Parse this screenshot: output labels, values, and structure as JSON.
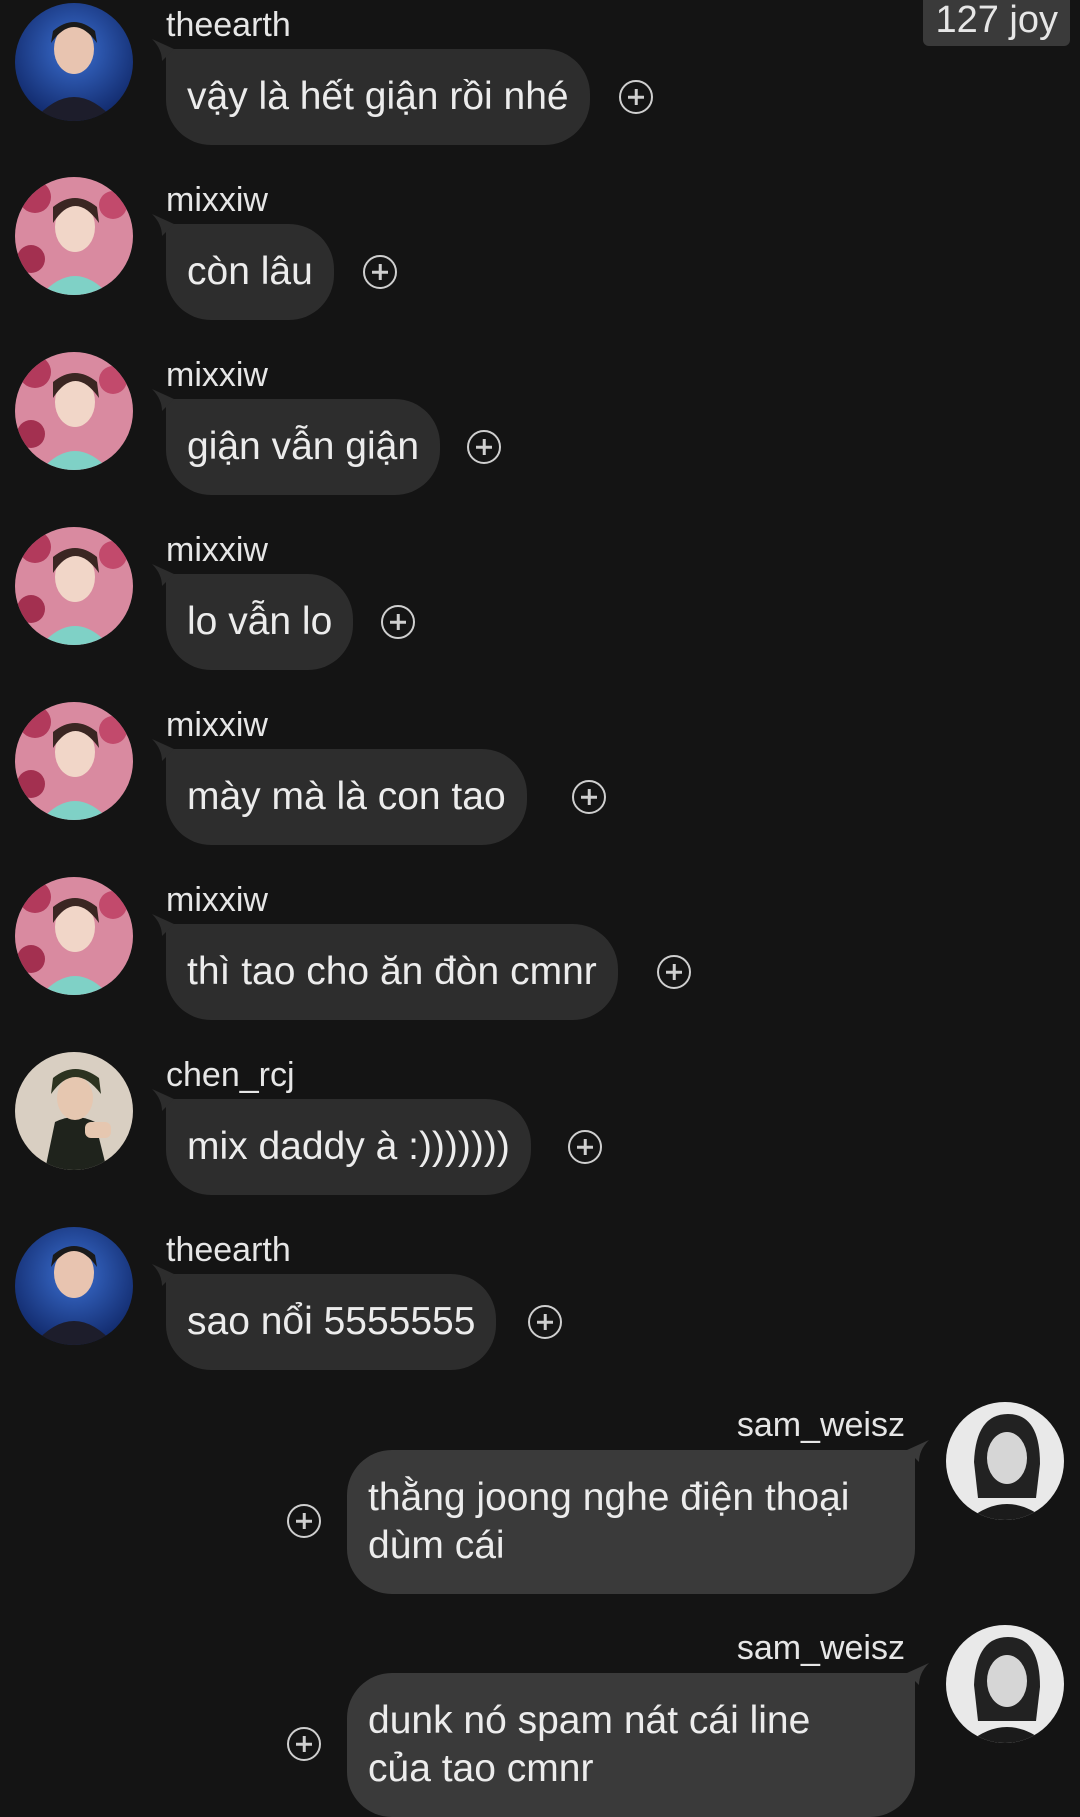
{
  "header": {
    "reaction_badge": "127 joy"
  },
  "messages": [
    {
      "user": "theearth",
      "avatar": "avatar-theearth",
      "text": "vậy là hết giận rồi nhé",
      "side": "left"
    },
    {
      "user": "mixxiw",
      "avatar": "avatar-mixxiw",
      "text": "còn lâu",
      "side": "left"
    },
    {
      "user": "mixxiw",
      "avatar": "avatar-mixxiw",
      "text": "giận vẫn giận",
      "side": "left"
    },
    {
      "user": "mixxiw",
      "avatar": "avatar-mixxiw",
      "text": "lo vẫn lo",
      "side": "left"
    },
    {
      "user": "mixxiw",
      "avatar": "avatar-mixxiw",
      "text": "mày mà là con tao",
      "side": "left"
    },
    {
      "user": "mixxiw",
      "avatar": "avatar-mixxiw",
      "text": "thì tao cho ăn đòn cmnr",
      "side": "left"
    },
    {
      "user": "chen_rcj",
      "avatar": "avatar-chen-rcj",
      "text": "mix daddy à :)))))))",
      "side": "left"
    },
    {
      "user": "theearth",
      "avatar": "avatar-theearth",
      "text": "sao nổi 5555555",
      "side": "left"
    },
    {
      "user": "sam_weisz",
      "avatar": "avatar-sam-weisz",
      "text_line1": "thằng joong nghe điện thoại",
      "text_line2": "dùm cái",
      "side": "right"
    },
    {
      "user": "sam_weisz",
      "avatar": "avatar-sam-weisz",
      "text_line1": "dunk nó spam nát cái line",
      "text_line2": "của tao cmnr",
      "side": "right"
    }
  ]
}
